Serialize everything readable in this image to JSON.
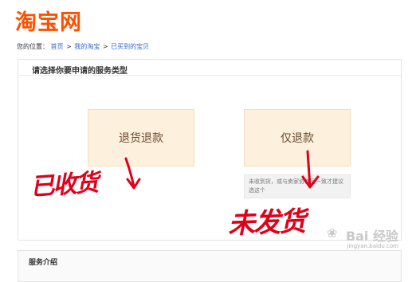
{
  "header": {
    "logo_text": "淘宝网"
  },
  "breadcrumb": {
    "prefix": "您的位置：",
    "items": [
      "首页",
      "我的淘宝",
      "已买到的宝贝"
    ],
    "separator": ">"
  },
  "panel": {
    "title": "请选择你要申请的服务类型",
    "buttons": {
      "refund_return": "退货退款",
      "refund_only": "仅退款"
    },
    "tip": "未收到货，或与卖家协商同一致才建议选这个"
  },
  "annotations": {
    "received": "已收货",
    "not_shipped": "未发货"
  },
  "section2": {
    "title": "服务介绍"
  },
  "watermark": {
    "brand": "Bai 经验",
    "url": "jingyan.baidu.com"
  },
  "colors": {
    "brand": "#ff5000",
    "annotation": "#e1001a",
    "button_bg": "#fdf1de",
    "link": "#3366cc"
  }
}
